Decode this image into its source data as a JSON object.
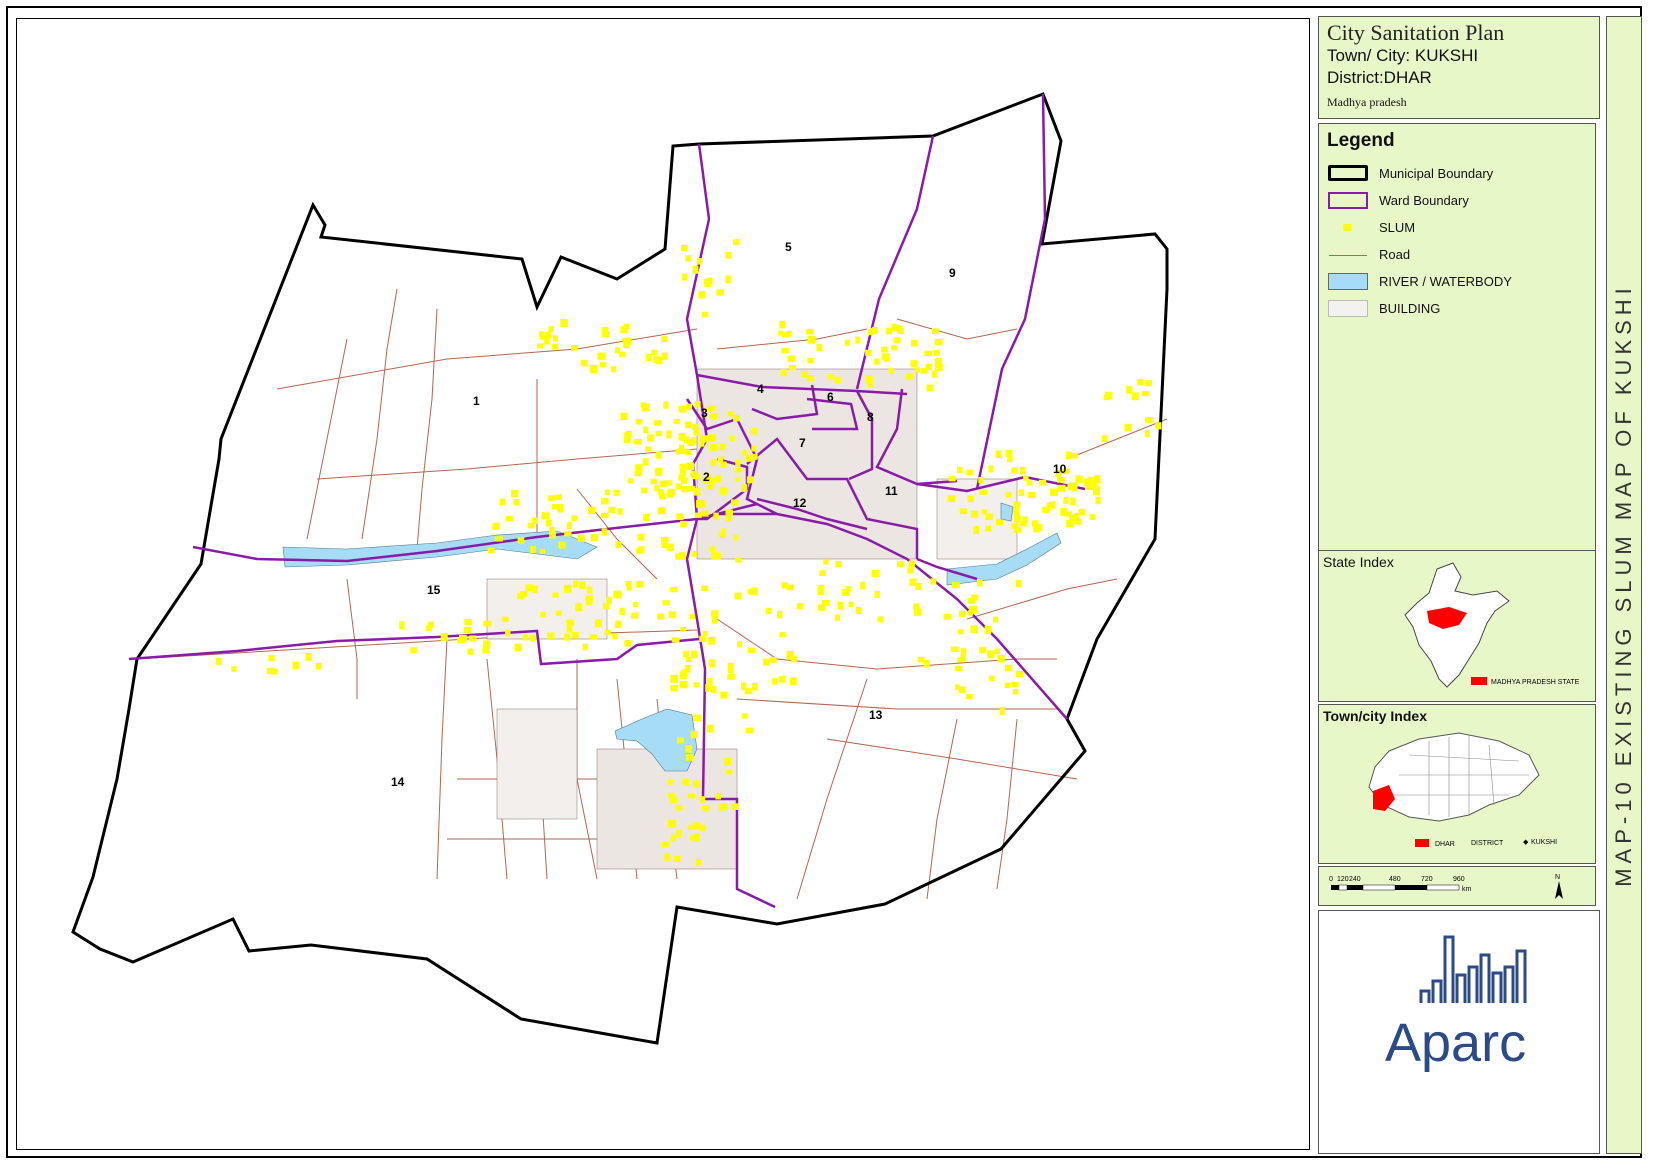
{
  "title": {
    "main": "City Sanitation Plan",
    "town": "Town/ City: KUKSHI",
    "district": "District:DHAR",
    "state": "Madhya pradesh"
  },
  "legend": {
    "heading": "Legend",
    "items": [
      {
        "label": "Municipal Boundary",
        "symbol": "municipal-boundary",
        "color": "#000000"
      },
      {
        "label": "Ward Boundary",
        "symbol": "ward-boundary",
        "color": "#8a1aa8"
      },
      {
        "label": "SLUM",
        "symbol": "slum",
        "color": "#ffff00"
      },
      {
        "label": "Road",
        "symbol": "road",
        "color": "#b3664f"
      },
      {
        "label": "RIVER / WATERBODY",
        "symbol": "river",
        "color": "#a6dcf5"
      },
      {
        "label": "BUILDING",
        "symbol": "building",
        "color": "#f4f2ee"
      }
    ]
  },
  "state_index": {
    "heading": "State Index",
    "legend_label": "MADHYA PRADESH STATE",
    "highlight_color": "#ff0000"
  },
  "town_index": {
    "heading": "Town/city Index",
    "legend_district": "DHAR",
    "legend_district_word": "DISTRICT",
    "legend_town": "KUKSHI",
    "highlight_color": "#ff0000"
  },
  "scale_bar": {
    "ticks": [
      "0",
      "120",
      "240",
      "480",
      "720",
      "960"
    ],
    "unit": "km",
    "north": "N"
  },
  "side_title": "MAP-10 EXISTING SLUM MAP OF KUKSHI",
  "logo": {
    "text": "Aparc"
  },
  "wards": [
    "1",
    "2",
    "3",
    "4",
    "5",
    "6",
    "7",
    "8",
    "9",
    "10",
    "11",
    "12",
    "13",
    "14",
    "15"
  ]
}
